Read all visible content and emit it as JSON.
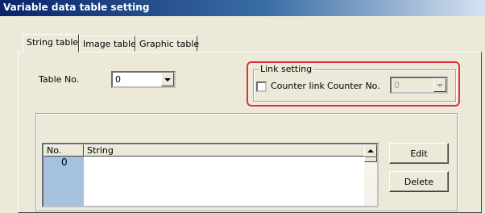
{
  "window": {
    "title": "Variable data table setting"
  },
  "tabs": [
    {
      "label": "String table",
      "active": true
    },
    {
      "label": "Image table",
      "active": false
    },
    {
      "label": "Graphic table",
      "active": false
    }
  ],
  "table_no": {
    "label": "Table No.",
    "value": "0"
  },
  "link_setting": {
    "legend": "Link setting",
    "counter_link_label": "Counter link",
    "counter_link_checked": false,
    "counter_no_label": "Counter No.",
    "counter_no_value": "0",
    "counter_no_disabled": true
  },
  "list": {
    "columns": [
      "No.",
      "String"
    ],
    "rows": [
      {
        "no": "0",
        "string": ""
      }
    ]
  },
  "buttons": {
    "edit": "Edit",
    "delete": "Delete"
  },
  "highlight_color": "#e0303a"
}
